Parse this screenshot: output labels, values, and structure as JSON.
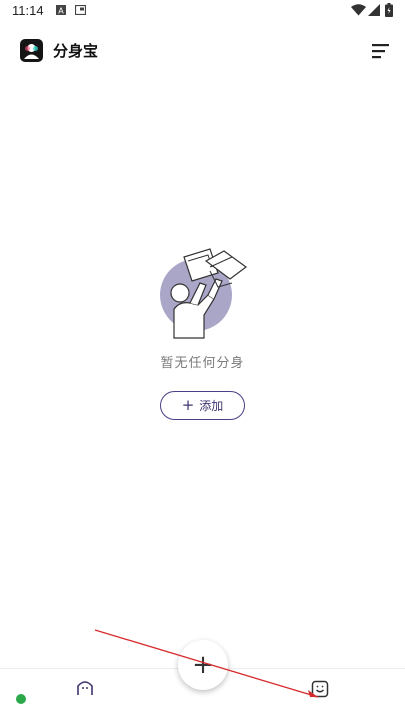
{
  "status_bar": {
    "time": "11:14",
    "icons": [
      "a-notification-icon",
      "screen-notification-icon",
      "wifi-icon",
      "signal-icon",
      "battery-icon"
    ]
  },
  "app_bar": {
    "title": "分身宝",
    "logo_icon": "app-logo-icon",
    "menu_icon": "sort-menu-icon"
  },
  "empty_state": {
    "illustration": "person-lifting-boxes",
    "message": "暂无任何分身",
    "add_button": {
      "plus": "+",
      "label": "添加"
    }
  },
  "bottom_nav": {
    "fab_label": "+",
    "items": [
      "home-face-icon",
      "smile-face-icon"
    ]
  },
  "colors": {
    "accent": "#4b3f86",
    "illustration_circle": "#a9a6c8",
    "annotation": "#d62b2b"
  }
}
